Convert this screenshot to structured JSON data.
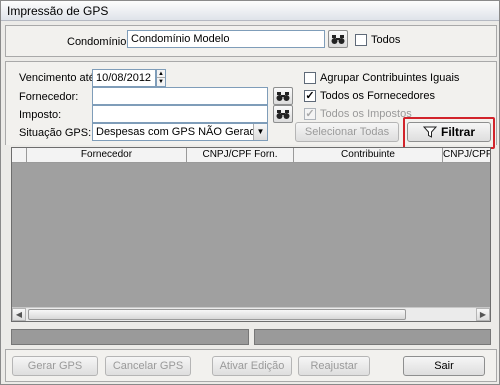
{
  "window": {
    "title": "Impressão de GPS"
  },
  "header": {
    "condominio_label": "Condomínio:",
    "condominio_value": "Condomínio Modelo",
    "todos_label": "Todos",
    "todos_checked": false
  },
  "filters": {
    "vencimento_label": "Vencimento até:",
    "vencimento_value": "10/08/2012",
    "fornecedor_label": "Fornecedor:",
    "fornecedor_value": "",
    "imposto_label": "Imposto:",
    "imposto_value": "",
    "situacao_label": "Situação GPS:",
    "situacao_value": "Despesas com GPS NÃO Geradas"
  },
  "options": {
    "agrupar_label": "Agrupar Contribuintes Iguais",
    "agrupar_checked": false,
    "todos_fornecedores_label": "Todos os Fornecedores",
    "todos_fornecedores_checked": true,
    "todos_impostos_label": "Todos os Impostos",
    "todos_impostos_checked": true,
    "todos_impostos_disabled": true
  },
  "actions": {
    "selecionar_todas": "Selecionar Todas",
    "filtrar": "Filtrar"
  },
  "grid": {
    "columns": [
      "Fornecedor",
      "CNPJ/CPF Forn.",
      "Contribuinte",
      "CNPJ/CPF"
    ]
  },
  "footer": {
    "gerar": "Gerar GPS",
    "cancelar": "Cancelar GPS",
    "ativar": "Ativar Edição",
    "reajustar": "Reajustar",
    "sair": "Sair"
  },
  "icons": {
    "binoculars": "binoculars-icon",
    "filter": "filter-icon"
  },
  "colors": {
    "highlight": "#d2232a"
  }
}
